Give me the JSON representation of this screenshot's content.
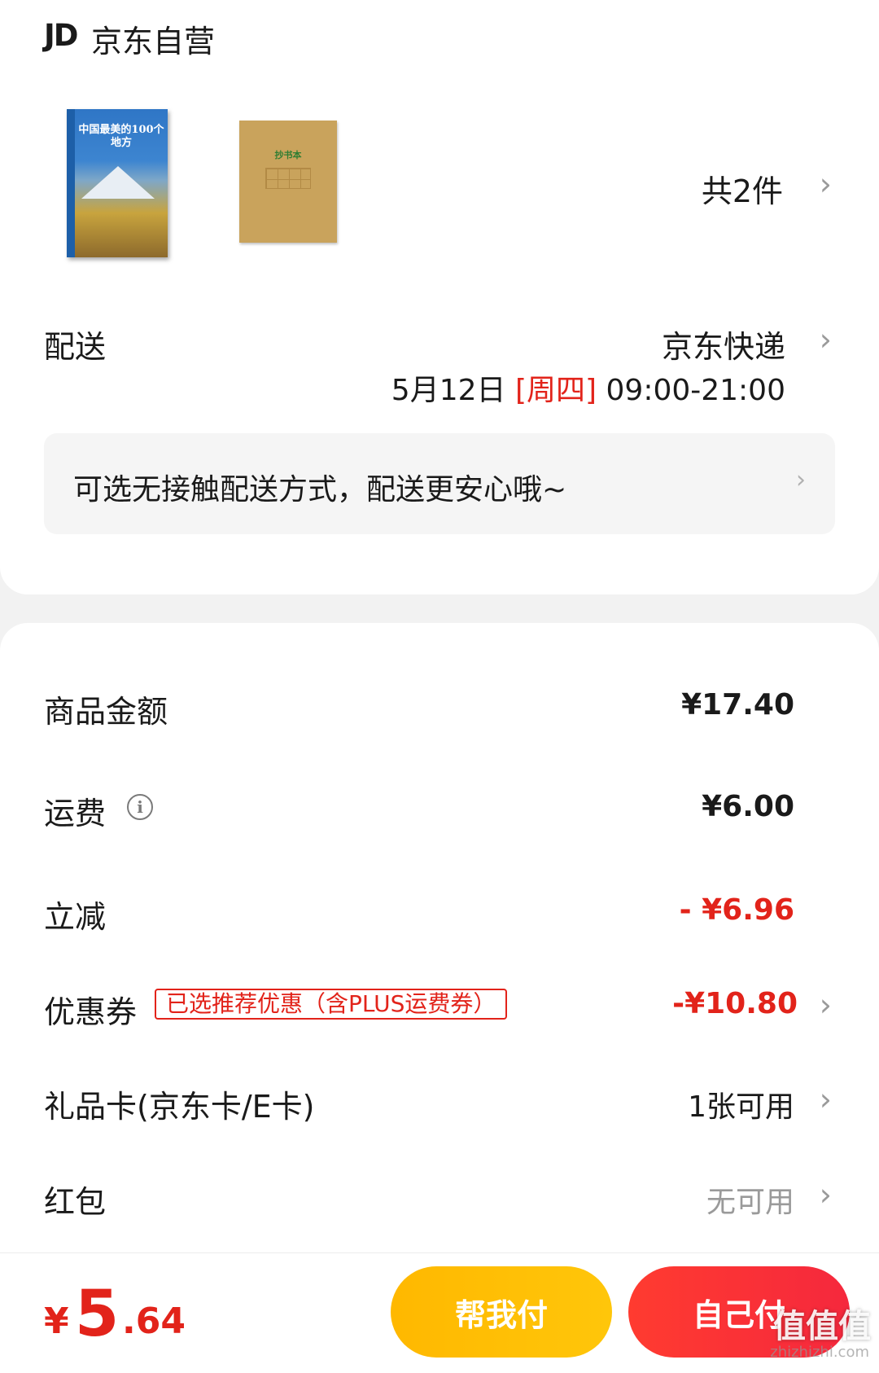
{
  "shop": {
    "logo": "JD",
    "name": "京东自营"
  },
  "products": {
    "book_title": "中国最美的100个地方",
    "notebook_title": "抄书本",
    "count": "共2件"
  },
  "delivery": {
    "label": "配送",
    "method": "京东快递",
    "date": "5月12日 ",
    "weekday": "[周四]",
    "time": " 09:00-21:00",
    "notice": "可选无接触配送方式，配送更安心哦~"
  },
  "fees": {
    "goods_label": "商品金额",
    "goods_value": "¥17.40",
    "shipping_label": "运费",
    "shipping_value": "¥6.00",
    "discount_label": "立减",
    "discount_value": "- ¥6.96",
    "coupon_label": "优惠券",
    "coupon_tag": "已选推荐优惠（含PLUS运费券）",
    "coupon_value": "-¥10.80",
    "giftcard_label": "礼品卡(京东卡/E卡)",
    "giftcard_value": "1张可用",
    "redpacket_label": "红包",
    "redpacket_value": "无可用"
  },
  "footer": {
    "currency": "¥",
    "total_int": "5",
    "total_dec": ".64",
    "help_pay": "帮我付",
    "self_pay": "自己付"
  },
  "watermark": {
    "logo": "值值值",
    "url": "zhizhizhi.com"
  },
  "colors": {
    "accent_red": "#e2231a",
    "help_button": "#ffc60a",
    "self_button": "#f5283d"
  },
  "icons": [
    "chevron-right-icon",
    "info-icon"
  ]
}
